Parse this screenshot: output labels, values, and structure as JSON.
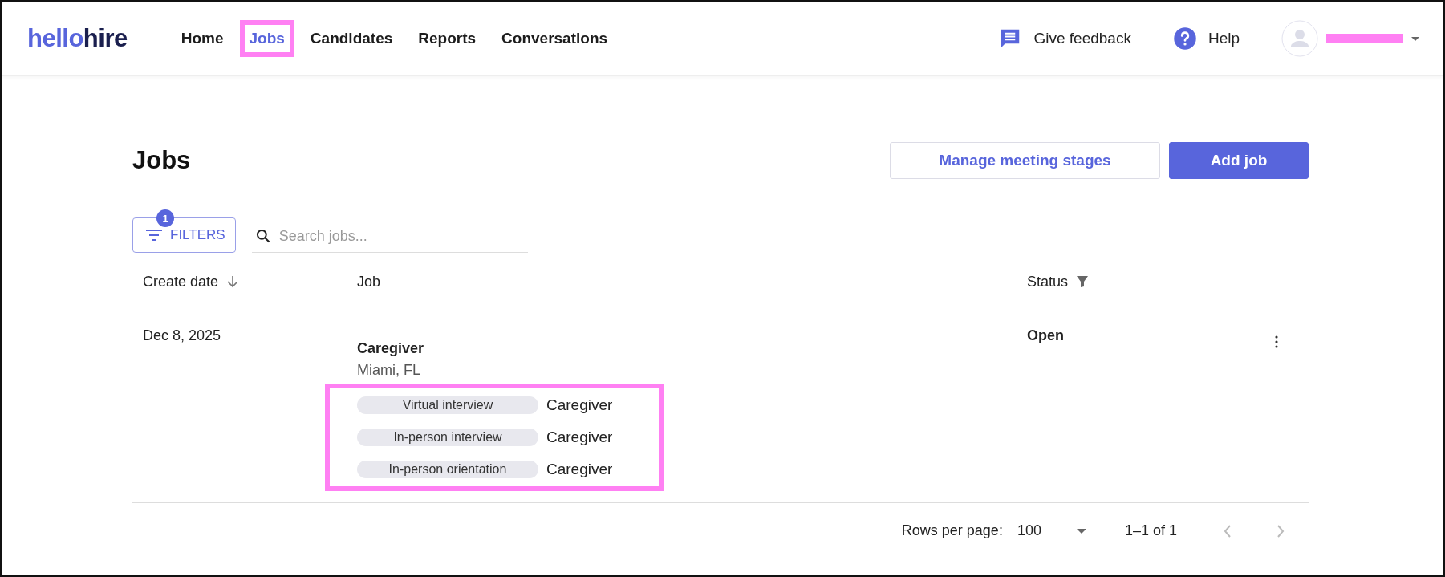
{
  "header": {
    "logo": {
      "brand": "hello",
      "suffix": "hire"
    },
    "nav": [
      {
        "label": "Home",
        "selected": false,
        "highlighted": false
      },
      {
        "label": "Jobs",
        "selected": true,
        "highlighted": true
      },
      {
        "label": "Candidates",
        "selected": false,
        "highlighted": false
      },
      {
        "label": "Reports",
        "selected": false,
        "highlighted": false
      },
      {
        "label": "Conversations",
        "selected": false,
        "highlighted": false
      }
    ],
    "feedback": "Give feedback",
    "help": "Help",
    "user": {
      "name_redacted": true
    }
  },
  "page": {
    "title": "Jobs",
    "buttons": [
      {
        "label": "Manage meeting stages",
        "kind": "outlined"
      },
      {
        "label": "Add job",
        "kind": "primary"
      }
    ],
    "filters": {
      "label": "FILTERS",
      "count": "1"
    },
    "search": {
      "placeholder": "Search jobs..."
    }
  },
  "table": {
    "columns": [
      {
        "label": "Create date",
        "kind": "sorted"
      },
      {
        "label": "Job",
        "kind": "plain"
      },
      {
        "label": "Status",
        "kind": "filtered"
      }
    ],
    "rows": [
      {
        "date": "Dec 8, 2025",
        "job": "Caregiver",
        "location": "Miami, FL",
        "stages_highlighted": true,
        "stages": [
          {
            "stage": "Virtual interview",
            "role": "Caregiver"
          },
          {
            "stage": "In-person interview",
            "role": "Caregiver"
          },
          {
            "stage": "In-person orientation",
            "role": "Caregiver"
          }
        ],
        "status": "Open"
      }
    ]
  },
  "pagination": {
    "rows_label": "Rows per page:",
    "rows_value": "100",
    "range": "1–1 of 1"
  }
}
